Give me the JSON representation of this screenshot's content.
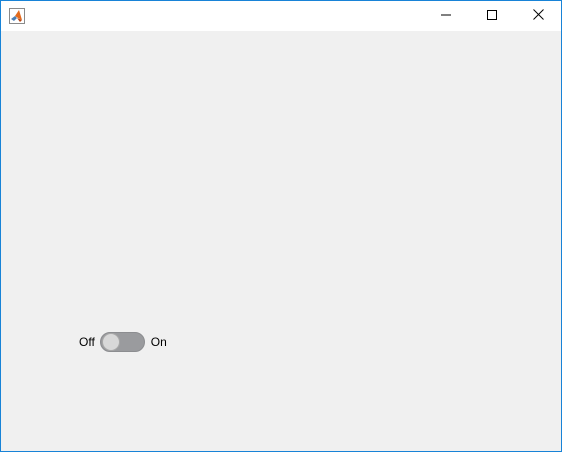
{
  "window": {
    "app_icon": "matlab-logo-icon",
    "buttons": {
      "minimize_icon": "minimize-icon",
      "maximize_icon": "maximize-icon",
      "close_icon": "close-icon"
    },
    "accent_color": "#1883d7",
    "background_color": "#f0f0f0"
  },
  "switch": {
    "off_label": "Off",
    "on_label": "On",
    "state": "Off"
  }
}
